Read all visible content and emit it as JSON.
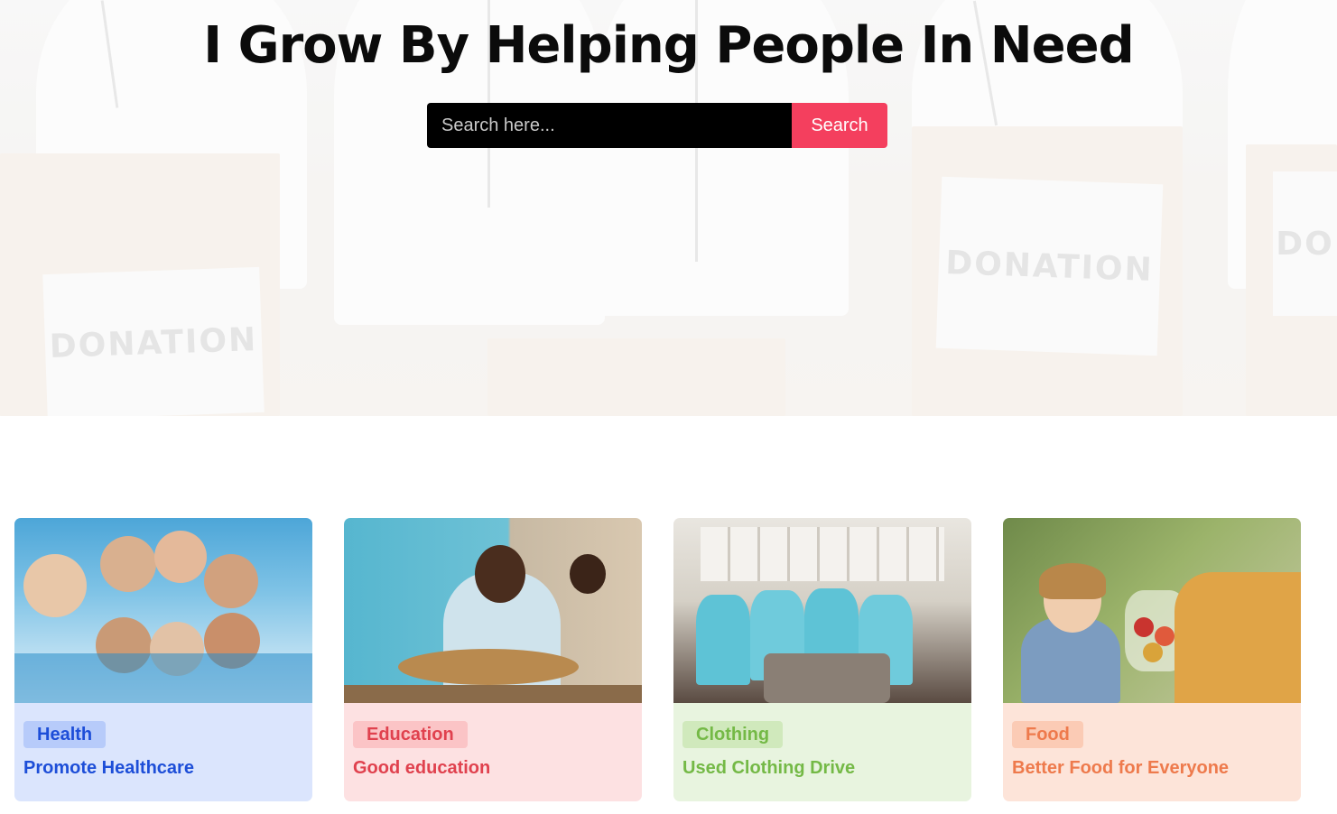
{
  "hero": {
    "title": "I Grow By Helping People In Need",
    "background_labels": [
      "DONATION",
      "DONATION",
      "DO"
    ]
  },
  "search": {
    "placeholder": "Search here...",
    "button_label": "Search",
    "button_color": "#f43f5e"
  },
  "cards": [
    {
      "category": "Health",
      "title": "Promote Healthcare",
      "bg": "#dbe5fd",
      "badge_bg": "#b7cbfa",
      "text_color": "#1d4ed8"
    },
    {
      "category": "Education",
      "title": "Good education",
      "bg": "#fde1e2",
      "badge_bg": "#fbc4c6",
      "text_color": "#e0414e"
    },
    {
      "category": "Clothing",
      "title": "Used Clothing Drive",
      "bg": "#e8f4df",
      "badge_bg": "#d0e9bc",
      "text_color": "#74b946"
    },
    {
      "category": "Food",
      "title": "Better Food for Everyone",
      "bg": "#fde4d9",
      "badge_bg": "#fbcbb5",
      "text_color": "#ee7a4c"
    }
  ]
}
